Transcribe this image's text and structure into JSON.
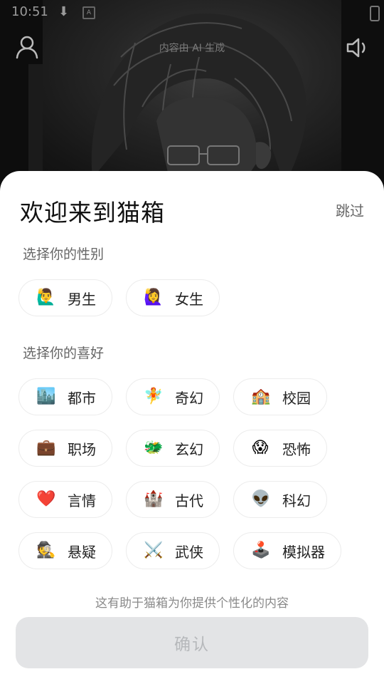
{
  "status_bar": {
    "time": "10:51"
  },
  "header": {
    "ai_note": "内容由 AI 生成"
  },
  "sheet": {
    "title": "欢迎来到猫箱",
    "skip_label": "跳过",
    "gender_label": "选择你的性别",
    "genders": [
      {
        "emoji": "🙋‍♂️",
        "label": "男生"
      },
      {
        "emoji": "🙋‍♀️",
        "label": "女生"
      }
    ],
    "preference_label": "选择你的喜好",
    "preferences": [
      {
        "emoji": "🏙️",
        "label": "都市"
      },
      {
        "emoji": "🧚",
        "label": "奇幻"
      },
      {
        "emoji": "🏫",
        "label": "校园"
      },
      {
        "emoji": "💼",
        "label": "职场"
      },
      {
        "emoji": "🐲",
        "label": "玄幻"
      },
      {
        "emoji": "😱",
        "label": "恐怖"
      },
      {
        "emoji": "❤️",
        "label": "言情"
      },
      {
        "emoji": "🏰",
        "label": "古代"
      },
      {
        "emoji": "👽",
        "label": "科幻"
      },
      {
        "emoji": "🕵️",
        "label": "悬疑"
      },
      {
        "emoji": "⚔️",
        "label": "武侠"
      },
      {
        "emoji": "🕹️",
        "label": "模拟器"
      }
    ],
    "hint": "这有助于猫箱为你提供个性化的内容",
    "confirm_label": "确认"
  },
  "colors": {
    "sheet_bg": "#ffffff",
    "confirm_disabled_bg": "#e3e4e6",
    "confirm_disabled_text": "#b6b8bb"
  }
}
